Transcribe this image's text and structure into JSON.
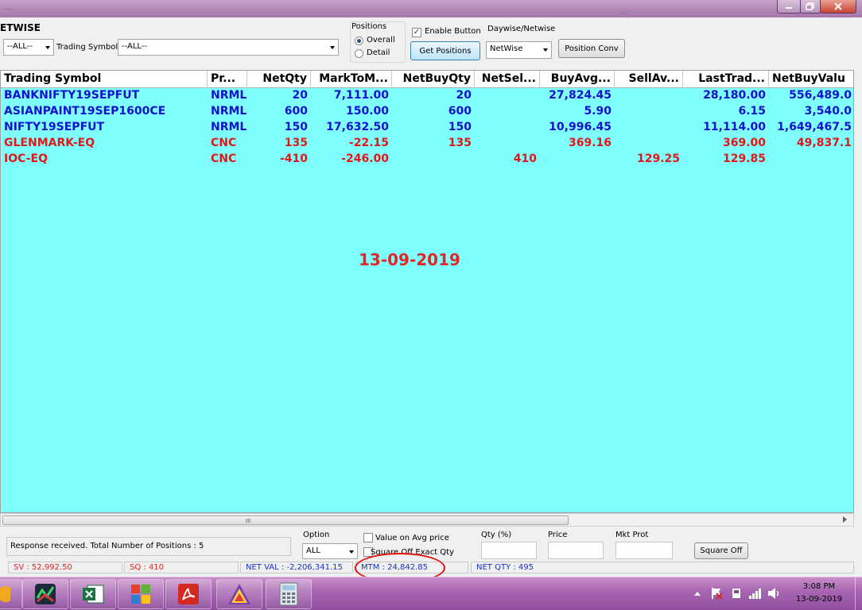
{
  "title_bar": {
    "blur_left": "...",
    "blur_right": "..."
  },
  "toolbar": {
    "mode_label": "ETWISE",
    "filter_all": "--ALL--",
    "trading_symbol_label": "Trading Symbol",
    "trading_symbol_value": "--ALL--",
    "positions_label": "Positions",
    "radio_overall": "Overall",
    "radio_detail": "Detail",
    "enable_button_label": "Enable Button",
    "get_positions": "Get Positions",
    "daywise_label": "Daywise/Netwise",
    "daywise_value": "NetWise",
    "position_conv": "Position Conv"
  },
  "grid": {
    "columns": [
      "Trading Symbol",
      "Pr...",
      "NetQty",
      "MarkToM...",
      "NetBuyQty",
      "NetSel...",
      "BuyAvg...",
      "SellAv...",
      "LastTrad...",
      "NetBuyValu"
    ],
    "rows": [
      {
        "color": "#1010d0",
        "cells": [
          "BANKNIFTY19SEPFUT",
          "NRML",
          "20",
          "7,111.00",
          "20",
          "",
          "27,824.45",
          "",
          "28,180.00",
          "556,489.0"
        ]
      },
      {
        "color": "#1010d0",
        "cells": [
          "ASIANPAINT19SEP1600CE",
          "NRML",
          "600",
          "150.00",
          "600",
          "",
          "5.90",
          "",
          "6.15",
          "3,540.0"
        ]
      },
      {
        "color": "#1010d0",
        "cells": [
          "NIFTY19SEPFUT",
          "NRML",
          "150",
          "17,632.50",
          "150",
          "",
          "10,996.45",
          "",
          "11,114.00",
          "1,649,467.5"
        ]
      },
      {
        "color": "#e01818",
        "cells": [
          "GLENMARK-EQ",
          "CNC",
          "135",
          "-22.15",
          "135",
          "",
          "369.16",
          "",
          "369.00",
          "49,837.1"
        ]
      },
      {
        "color": "#e01818",
        "cells": [
          "IOC-EQ",
          "CNC",
          "-410",
          "-246.00",
          "",
          "410",
          "",
          "129.25",
          "129.85",
          ""
        ]
      }
    ],
    "date_overlay": "13-09-2019",
    "scroll_grip": "III"
  },
  "bottom": {
    "status_message": "Response received. Total Number of Positions : 5",
    "option_label": "Option",
    "option_value": "ALL",
    "value_on_avg_price": "Value on Avg  price",
    "square_off_exact_qty": "Square Off Exact Qty",
    "qty_pct_label": "Qty (%)",
    "price_label": "Price",
    "mkt_prot_label": "Mkt Prot",
    "square_off_button": "Square Off"
  },
  "status_strip": {
    "sv": "SV : 52,992.50",
    "sq": "SQ : 410",
    "net_val": "NET VAL : -2,206,341.15",
    "mtm": "MTM : 24,842.85",
    "net_qty": "NET QTY : 495"
  },
  "taskbar": {
    "clock_time": "3:08 PM",
    "clock_date": "13-09-2019"
  }
}
